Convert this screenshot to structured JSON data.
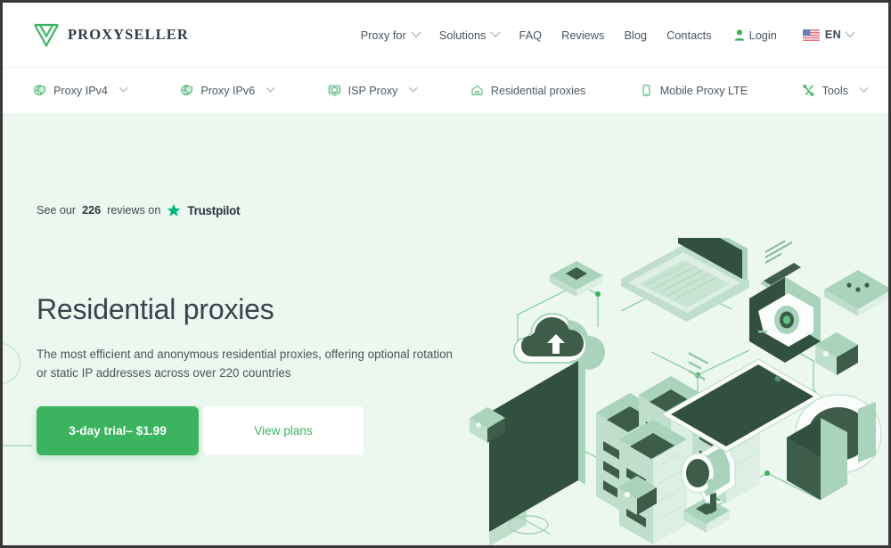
{
  "brand": {
    "logo_icon": "proxyseller-w-mark-icon",
    "name": "PROXYSELLER",
    "accent": "#3cb45f",
    "hero_bg": "#ecf7f0",
    "heading_color": "#39424e"
  },
  "topnav": {
    "items": [
      {
        "label": "Proxy for",
        "icon": "chevron-down-icon",
        "has_chevron": true
      },
      {
        "label": "Solutions",
        "icon": "chevron-down-icon",
        "has_chevron": true
      },
      {
        "label": "FAQ",
        "has_chevron": false
      },
      {
        "label": "Reviews",
        "has_chevron": false
      },
      {
        "label": "Blog",
        "has_chevron": false
      },
      {
        "label": "Contacts",
        "has_chevron": false
      }
    ],
    "login": {
      "label": "Login",
      "icon": "user-icon"
    },
    "language": {
      "code": "EN",
      "flag": "us-flag-icon",
      "icon": "chevron-down-icon"
    }
  },
  "subnav": {
    "items": [
      {
        "label": "Proxy IPv4",
        "icon": "globe-shield-icon",
        "has_chevron": true
      },
      {
        "label": "Proxy IPv6",
        "icon": "globe-shield-icon",
        "has_chevron": true
      },
      {
        "label": "ISP Proxy",
        "icon": "monitor-shield-icon",
        "has_chevron": true
      },
      {
        "label": "Residential proxies",
        "icon": "home-icon",
        "has_chevron": false
      },
      {
        "label": "Mobile Proxy LTE",
        "icon": "mobile-phone-icon",
        "has_chevron": false
      },
      {
        "label": "Tools",
        "icon": "crossed-tools-icon",
        "has_chevron": true
      }
    ]
  },
  "hero": {
    "trustpilot": {
      "prefix": "See our",
      "count": "226",
      "suffix": "reviews on",
      "brand": "Trustpilot",
      "star_icon": "trustpilot-star-icon",
      "star_color": "#00b67a"
    },
    "title": "Residential proxies",
    "description": "The most efficient and anonymous residential proxies, offering optional rotation or static IP addresses across over 220 countries",
    "primary_cta": "3-day trial– $1.99",
    "secondary_cta": "View plans",
    "illustration": "isometric-network-devices-illustration"
  }
}
